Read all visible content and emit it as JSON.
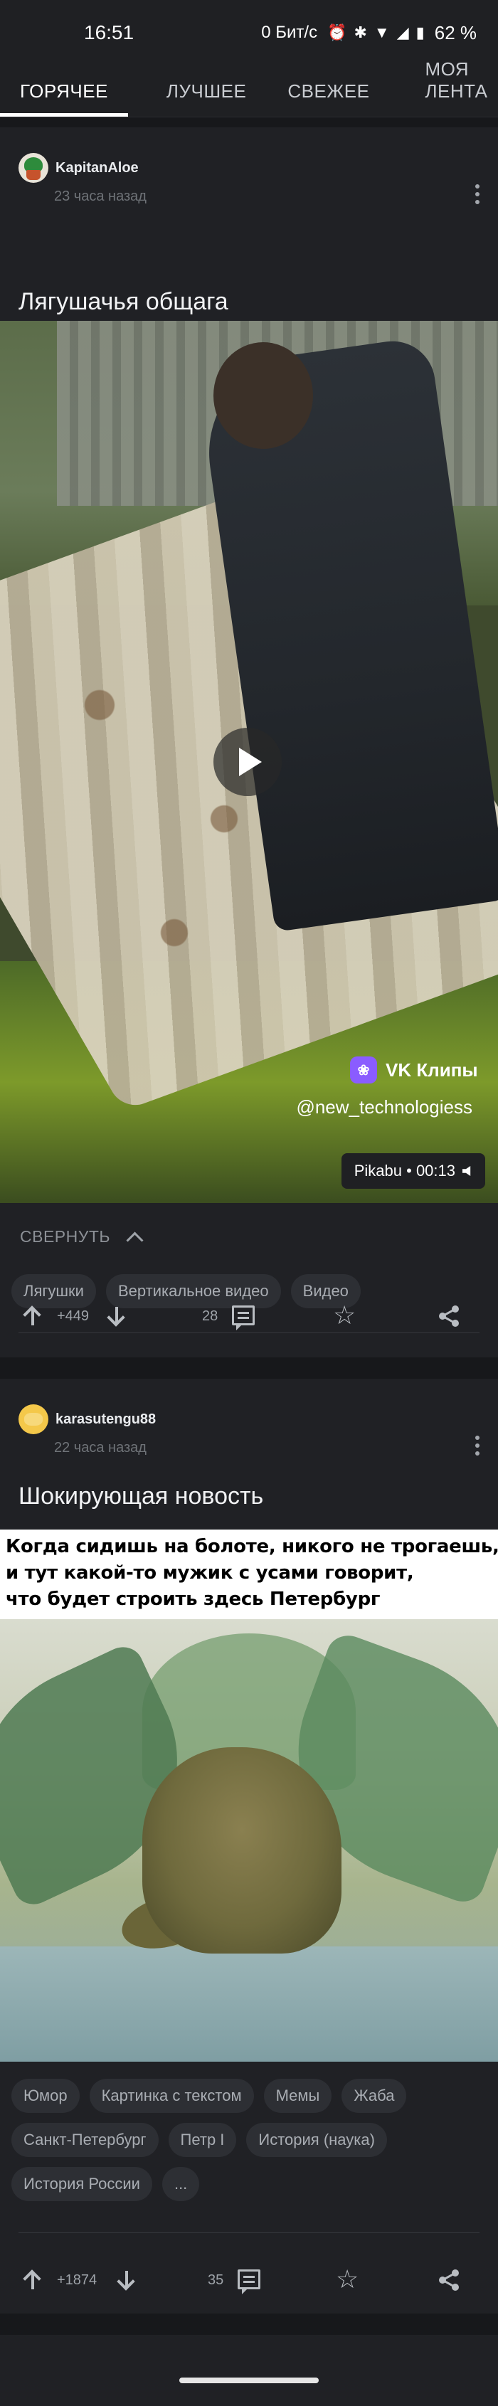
{
  "status_bar": {
    "time": "16:51",
    "net_speed": "0 Бит/с",
    "battery": "62 %",
    "icons": [
      "alarm-icon",
      "bluetooth-icon",
      "wifi-icon",
      "signal-icon"
    ]
  },
  "tabs": [
    {
      "label": "ГОРЯЧЕЕ",
      "active": true
    },
    {
      "label": "ЛУЧШЕЕ",
      "active": false
    },
    {
      "label": "СВЕЖЕЕ",
      "active": false
    },
    {
      "label": "МОЯ ЛЕНТА",
      "active": false
    }
  ],
  "posts": [
    {
      "author": "KapitanAloe",
      "time": "23 часа назад",
      "title": "Лягушачья общага",
      "media": {
        "type": "video",
        "overlay_brand": "VK Клипы",
        "overlay_user": "@new_technologiess",
        "duration_label": "Pikabu • 00:13"
      },
      "collapse_label": "СВЕРНУТЬ",
      "tags": [
        "Лягушки",
        "Вертикальное видео",
        "Видео"
      ],
      "rating": "+449",
      "comments": "28"
    },
    {
      "author": "karasutengu88",
      "time": "22 часа назад",
      "title": "Шокирующая новость",
      "media": {
        "type": "image",
        "caption_lines": [
          "Когда сидишь на болоте, никого не трогаешь,",
          "и тут какой-то мужик с усами говорит,",
          "что будет строить здесь Петербург"
        ]
      },
      "tags": [
        "Юмор",
        "Картинка с текстом",
        "Мемы",
        "Жаба",
        "Санкт-Петербург",
        "Петр I",
        "История (наука)",
        "История России",
        "..."
      ],
      "rating": "+1874",
      "comments": "35"
    }
  ]
}
